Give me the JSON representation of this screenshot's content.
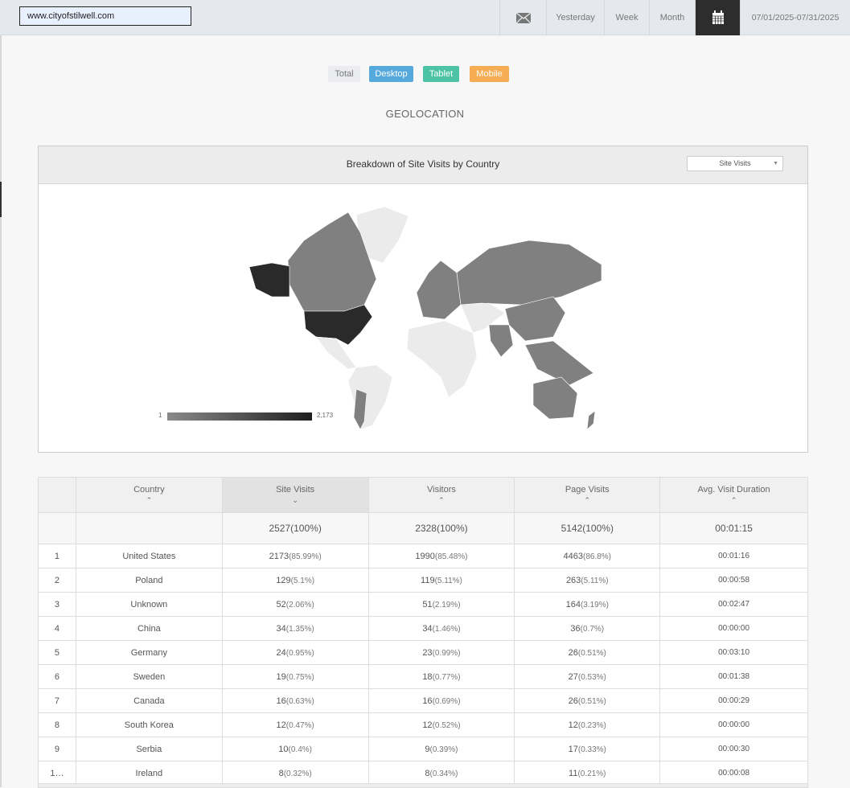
{
  "topbar": {
    "site": "www.cityofstilwell.com",
    "email_icon": "envelope-icon",
    "yesterday": "Yesterday",
    "week": "Week",
    "month": "Month",
    "calendar_icon": "calendar-icon",
    "date_range": "07/01/2025-07/31/2025"
  },
  "devices": {
    "total": "Total",
    "desktop": "Desktop",
    "tablet": "Tablet",
    "mobile": "Mobile",
    "colors": {
      "total": "#eaecef",
      "desktop": "#55a9dc",
      "tablet": "#4cc3a4",
      "mobile": "#f5ac52"
    }
  },
  "section_title": "GEOLOCATION",
  "map_panel": {
    "title": "Breakdown of Site Visits by Country",
    "metric": "Site Visits",
    "legend_min": "1",
    "legend_max": "2,173"
  },
  "table": {
    "headers": [
      "Country",
      "Site Visits",
      "Visitors",
      "Page Visits",
      "Avg. Visit Duration"
    ],
    "total": {
      "site_visits": "2527",
      "site_visits_pct": "(100%)",
      "visitors": "2328",
      "visitors_pct": "(100%)",
      "page_visits": "5142",
      "page_visits_pct": "(100%)",
      "duration": "00:01:15"
    },
    "rows": [
      {
        "n": "1",
        "country": "United States",
        "sv": "2173",
        "svp": "(85.99%)",
        "v": "1990",
        "vp": "(85.48%)",
        "pv": "4463",
        "pvp": "(86.8%)",
        "d": "00:01:16"
      },
      {
        "n": "2",
        "country": "Poland",
        "sv": "129",
        "svp": "(5.1%)",
        "v": "119",
        "vp": "(5.11%)",
        "pv": "263",
        "pvp": "(5.11%)",
        "d": "00:00:58"
      },
      {
        "n": "3",
        "country": "Unknown",
        "sv": "52",
        "svp": "(2.06%)",
        "v": "51",
        "vp": "(2.19%)",
        "pv": "164",
        "pvp": "(3.19%)",
        "d": "00:02:47"
      },
      {
        "n": "4",
        "country": "China",
        "sv": "34",
        "svp": "(1.35%)",
        "v": "34",
        "vp": "(1.46%)",
        "pv": "36",
        "pvp": "(0.7%)",
        "d": "00:00:00"
      },
      {
        "n": "5",
        "country": "Germany",
        "sv": "24",
        "svp": "(0.95%)",
        "v": "23",
        "vp": "(0.99%)",
        "pv": "26",
        "pvp": "(0.51%)",
        "d": "00:03:10"
      },
      {
        "n": "6",
        "country": "Sweden",
        "sv": "19",
        "svp": "(0.75%)",
        "v": "18",
        "vp": "(0.77%)",
        "pv": "27",
        "pvp": "(0.53%)",
        "d": "00:01:38"
      },
      {
        "n": "7",
        "country": "Canada",
        "sv": "16",
        "svp": "(0.63%)",
        "v": "16",
        "vp": "(0.69%)",
        "pv": "26",
        "pvp": "(0.51%)",
        "d": "00:00:29"
      },
      {
        "n": "8",
        "country": "South Korea",
        "sv": "12",
        "svp": "(0.47%)",
        "v": "12",
        "vp": "(0.52%)",
        "pv": "12",
        "pvp": "(0.23%)",
        "d": "00:00:00"
      },
      {
        "n": "9",
        "country": "Serbia",
        "sv": "10",
        "svp": "(0.4%)",
        "v": "9",
        "vp": "(0.39%)",
        "pv": "17",
        "pvp": "(0.33%)",
        "d": "00:00:30"
      },
      {
        "n": "1…",
        "country": "Ireland",
        "sv": "8",
        "svp": "(0.32%)",
        "v": "8",
        "vp": "(0.34%)",
        "pv": "11",
        "pvp": "(0.21%)",
        "d": "00:00:08"
      }
    ]
  }
}
